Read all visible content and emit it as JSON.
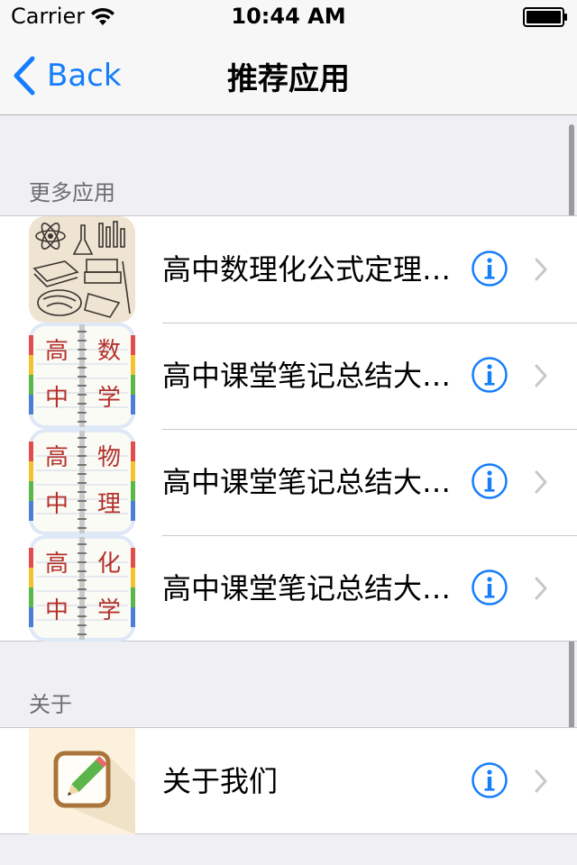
{
  "status_bar": {
    "carrier": "Carrier",
    "time": "10:44 AM",
    "wifi_icon": "wifi-icon",
    "battery_icon": "battery-icon"
  },
  "nav": {
    "back_label": "Back",
    "title": "推荐应用"
  },
  "sections": {
    "more_apps": {
      "header": "更多应用",
      "rows": [
        {
          "title": "高中数理化公式定理…",
          "icon": "science-collage-icon"
        },
        {
          "title": "高中课堂笔记总结大…",
          "icon": "notebook-icon",
          "icon_chars": [
            "高",
            "数",
            "中",
            "学"
          ]
        },
        {
          "title": "高中课堂笔记总结大…",
          "icon": "notebook-icon",
          "icon_chars": [
            "高",
            "物",
            "中",
            "理"
          ]
        },
        {
          "title": "高中课堂笔记总结大…",
          "icon": "notebook-icon",
          "icon_chars": [
            "高",
            "化",
            "中",
            "学"
          ]
        }
      ]
    },
    "about": {
      "header": "关于",
      "rows": [
        {
          "title": "关于我们",
          "icon": "notepad-pencil-icon"
        }
      ]
    }
  },
  "colors": {
    "accent": "#157efb",
    "background": "#efeff4",
    "notebook_red": "#b5312b"
  }
}
